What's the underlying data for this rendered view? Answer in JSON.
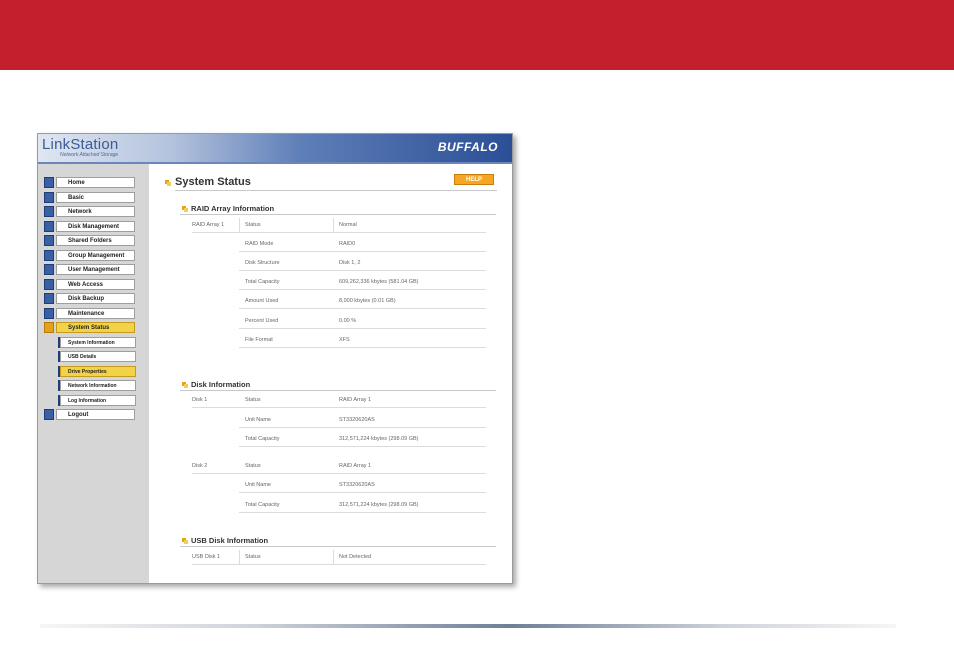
{
  "logo": {
    "name": "LinkStation",
    "tagline": "Network Attached Storage"
  },
  "brand": "BUFFALO",
  "help_label": "HELP",
  "page_title": "System Status",
  "nav": {
    "items": [
      {
        "label": "Home"
      },
      {
        "label": "Basic"
      },
      {
        "label": "Network"
      },
      {
        "label": "Disk Management"
      },
      {
        "label": "Shared Folders"
      },
      {
        "label": "Group Management"
      },
      {
        "label": "User Management"
      },
      {
        "label": "Web Access"
      },
      {
        "label": "Disk Backup"
      },
      {
        "label": "Maintenance"
      },
      {
        "label": "System Status",
        "active": true
      }
    ],
    "sub_items": [
      {
        "label": "System Information"
      },
      {
        "label": "USB Details"
      },
      {
        "label": "Drive Properties",
        "active": true
      },
      {
        "label": "Network Information"
      },
      {
        "label": "Log Information"
      }
    ],
    "logout": "Logout"
  },
  "raid": {
    "title": "RAID Array Information",
    "group": "RAID Array 1",
    "rows": [
      {
        "label": "Status",
        "value": "Normal"
      },
      {
        "label": "RAID Mode",
        "value": "RAID0"
      },
      {
        "label": "Disk Structure",
        "value": "Disk 1, 2"
      },
      {
        "label": "Total Capacity",
        "value": "609,262,336 kbytes (581.04 GB)"
      },
      {
        "label": "Amount Used",
        "value": "8,000 kbytes (0.01 GB)"
      },
      {
        "label": "Percent Used",
        "value": "0.00 %"
      },
      {
        "label": "File Format",
        "value": "XFS"
      }
    ]
  },
  "disk": {
    "title": "Disk Information",
    "disks": [
      {
        "name": "Disk 1",
        "rows": [
          {
            "label": "Status",
            "value": "RAID Array 1"
          },
          {
            "label": "Unit Name",
            "value": "ST3320620AS"
          },
          {
            "label": "Total Capacity",
            "value": "312,571,224 kbytes (298.09 GB)"
          }
        ]
      },
      {
        "name": "Disk 2",
        "rows": [
          {
            "label": "Status",
            "value": "RAID Array 1"
          },
          {
            "label": "Unit Name",
            "value": "ST3320620AS"
          },
          {
            "label": "Total Capacity",
            "value": "312,571,224 kbytes (298.09 GB)"
          }
        ]
      }
    ]
  },
  "usb": {
    "title": "USB Disk Information",
    "group": "USB Disk 1",
    "rows": [
      {
        "label": "Status",
        "value": "Not Detected"
      }
    ]
  }
}
